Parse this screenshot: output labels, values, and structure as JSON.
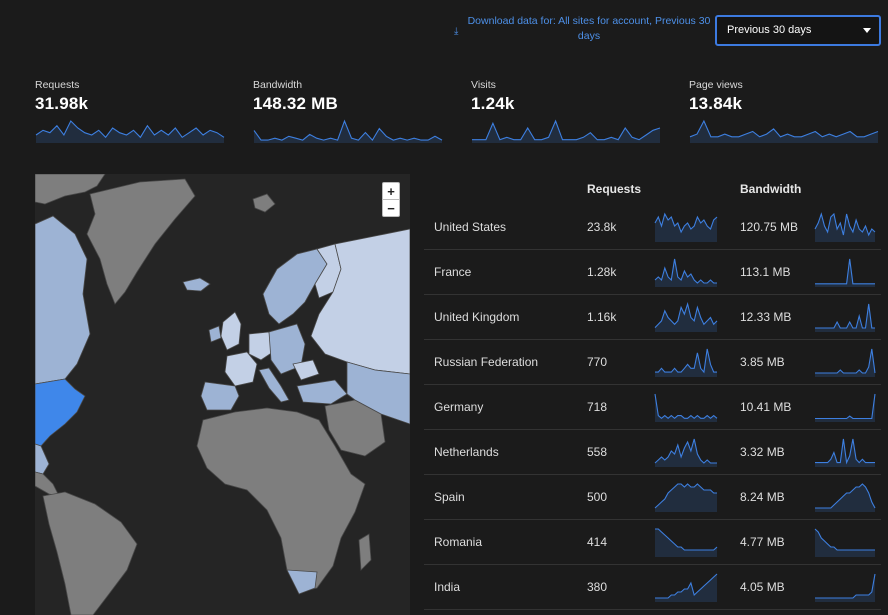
{
  "header": {
    "download_link": "Download data for: All sites for account, Previous 30 days",
    "period_select": "Previous 30 days"
  },
  "stats": [
    {
      "label": "Requests",
      "value": "31.98k",
      "trend": [
        3,
        5,
        4,
        7,
        3,
        9,
        6,
        4,
        3,
        5,
        2,
        6,
        4,
        3,
        5,
        2,
        7,
        3,
        5,
        3,
        6,
        2,
        4,
        6,
        3,
        5,
        4,
        2
      ]
    },
    {
      "label": "Bandwidth",
      "value": "148.32 MB",
      "trend": [
        6,
        1,
        1,
        2,
        1,
        3,
        2,
        1,
        4,
        2,
        1,
        2,
        1,
        11,
        2,
        1,
        5,
        1,
        7,
        3,
        1,
        2,
        1,
        2,
        1,
        1,
        3,
        1
      ]
    },
    {
      "label": "Visits",
      "value": "1.24k",
      "trend": [
        1,
        1,
        1,
        8,
        1,
        2,
        1,
        1,
        6,
        1,
        1,
        2,
        9,
        1,
        1,
        1,
        2,
        4,
        1,
        1,
        2,
        1,
        6,
        2,
        1,
        3,
        5,
        6
      ]
    },
    {
      "label": "Page views",
      "value": "13.84k",
      "trend": [
        2,
        3,
        8,
        2,
        2,
        3,
        2,
        2,
        3,
        4,
        2,
        3,
        5,
        2,
        3,
        2,
        2,
        3,
        4,
        2,
        3,
        2,
        3,
        4,
        2,
        2,
        3,
        4
      ]
    }
  ],
  "map": {
    "zoom_in": "+",
    "zoom_out": "−",
    "colors": {
      "ocean": "#252525",
      "land": "#7e7e7e",
      "low": "#9db3d4",
      "mid": "#c3d0e6",
      "high": "#3f87ea",
      "border": "#4a4a4a"
    }
  },
  "table": {
    "col_requests": "Requests",
    "col_bandwidth": "Bandwidth",
    "rows": [
      {
        "country": "United States",
        "requests": "23.8k",
        "bandwidth": "120.75 MB",
        "req_trend": [
          6,
          8,
          5,
          9,
          7,
          8,
          5,
          6,
          3,
          5,
          6,
          4,
          5,
          8,
          6,
          7,
          5,
          4,
          7,
          8
        ],
        "bw_trend": [
          4,
          6,
          9,
          5,
          3,
          8,
          9,
          4,
          6,
          2,
          9,
          5,
          3,
          7,
          4,
          3,
          5,
          2,
          4,
          3
        ]
      },
      {
        "country": "France",
        "requests": "1.28k",
        "bandwidth": "113.1 MB",
        "req_trend": [
          2,
          3,
          2,
          6,
          3,
          2,
          9,
          3,
          2,
          5,
          3,
          4,
          2,
          1,
          2,
          1,
          1,
          2,
          1,
          1
        ],
        "bw_trend": [
          1,
          1,
          1,
          1,
          1,
          1,
          1,
          1,
          1,
          1,
          1,
          12,
          1,
          1,
          1,
          1,
          1,
          1,
          1,
          1
        ]
      },
      {
        "country": "United Kingdom",
        "requests": "1.16k",
        "bandwidth": "12.33 MB",
        "req_trend": [
          1,
          2,
          3,
          6,
          4,
          3,
          2,
          3,
          7,
          5,
          8,
          4,
          3,
          7,
          4,
          2,
          3,
          4,
          2,
          3
        ],
        "bw_trend": [
          1,
          1,
          1,
          1,
          1,
          1,
          1,
          3,
          1,
          1,
          1,
          3,
          1,
          1,
          5,
          1,
          1,
          9,
          1,
          1
        ]
      },
      {
        "country": "Russian Federation",
        "requests": "770",
        "bandwidth": "3.85 MB",
        "req_trend": [
          1,
          1,
          2,
          1,
          1,
          1,
          2,
          1,
          1,
          2,
          3,
          2,
          2,
          6,
          2,
          1,
          7,
          3,
          1,
          1
        ],
        "bw_trend": [
          1,
          1,
          1,
          1,
          1,
          1,
          1,
          1,
          2,
          1,
          1,
          1,
          1,
          1,
          2,
          1,
          1,
          3,
          9,
          1
        ]
      },
      {
        "country": "Germany",
        "requests": "718",
        "bandwidth": "10.41 MB",
        "req_trend": [
          10,
          2,
          1,
          2,
          1,
          2,
          1,
          2,
          2,
          1,
          1,
          2,
          1,
          2,
          1,
          1,
          2,
          1,
          2,
          1
        ],
        "bw_trend": [
          1,
          1,
          1,
          1,
          1,
          1,
          1,
          1,
          1,
          1,
          1,
          2,
          1,
          1,
          1,
          1,
          1,
          1,
          1,
          11
        ]
      },
      {
        "country": "Netherlands",
        "requests": "558",
        "bandwidth": "3.32 MB",
        "req_trend": [
          1,
          2,
          3,
          2,
          3,
          5,
          4,
          7,
          3,
          6,
          8,
          5,
          9,
          4,
          2,
          1,
          2,
          1,
          1,
          1
        ],
        "bw_trend": [
          1,
          1,
          1,
          1,
          1,
          2,
          4,
          1,
          1,
          8,
          1,
          3,
          8,
          2,
          1,
          2,
          1,
          1,
          1,
          1
        ]
      },
      {
        "country": "Spain",
        "requests": "500",
        "bandwidth": "8.24 MB",
        "req_trend": [
          1,
          2,
          3,
          4,
          6,
          7,
          8,
          9,
          9,
          8,
          9,
          8,
          8,
          9,
          8,
          7,
          7,
          7,
          6,
          6
        ],
        "bw_trend": [
          1,
          1,
          1,
          1,
          1,
          1,
          2,
          3,
          4,
          5,
          6,
          6,
          7,
          8,
          8,
          9,
          8,
          6,
          3,
          1
        ]
      },
      {
        "country": "Romania",
        "requests": "414",
        "bandwidth": "4.77 MB",
        "req_trend": [
          9,
          9,
          8,
          7,
          6,
          5,
          4,
          3,
          3,
          2,
          2,
          2,
          2,
          2,
          2,
          2,
          2,
          2,
          2,
          3
        ],
        "bw_trend": [
          9,
          8,
          6,
          5,
          4,
          3,
          3,
          2,
          2,
          2,
          2,
          2,
          2,
          2,
          2,
          2,
          2,
          2,
          2,
          2
        ]
      },
      {
        "country": "India",
        "requests": "380",
        "bandwidth": "4.05 MB",
        "req_trend": [
          1,
          1,
          1,
          1,
          1,
          2,
          2,
          3,
          3,
          4,
          4,
          6,
          2,
          3,
          4,
          5,
          6,
          7,
          8,
          9
        ],
        "bw_trend": [
          1,
          1,
          1,
          1,
          1,
          1,
          1,
          1,
          1,
          1,
          1,
          1,
          1,
          2,
          2,
          2,
          2,
          2,
          3,
          9
        ]
      }
    ]
  }
}
